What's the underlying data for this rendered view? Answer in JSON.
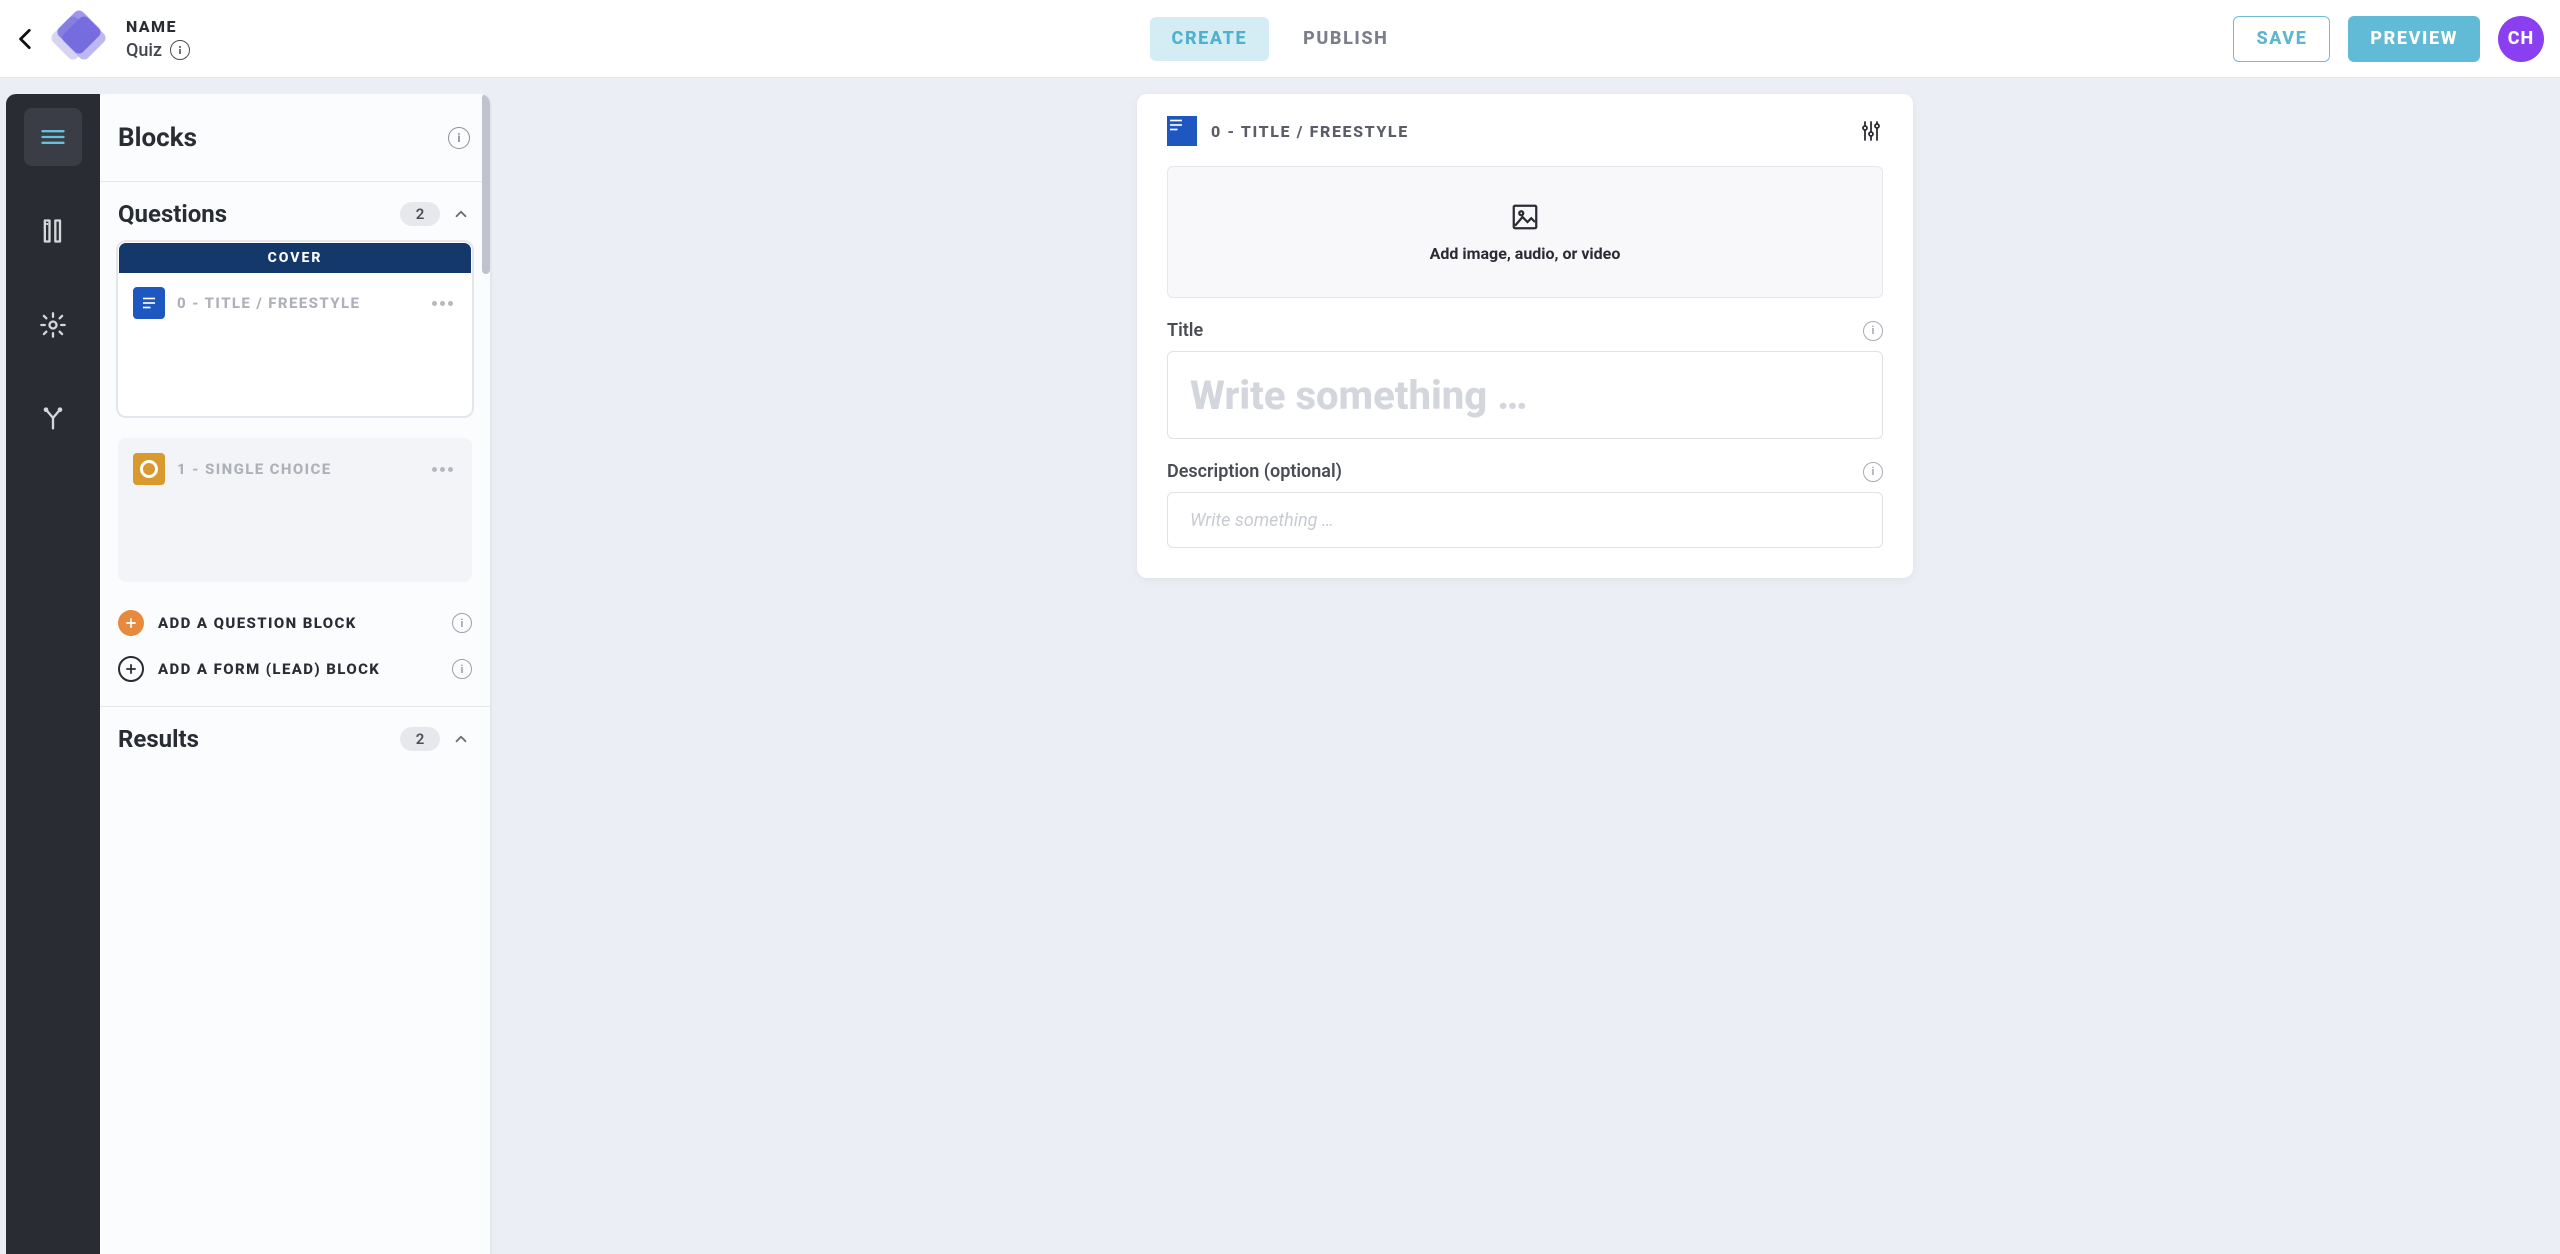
{
  "header": {
    "name_label": "NAME",
    "subtitle": "Quiz",
    "tab_create": "CREATE",
    "tab_publish": "PUBLISH",
    "save": "SAVE",
    "preview": "PREVIEW",
    "avatar": "CH"
  },
  "panel": {
    "title": "Blocks",
    "sections": {
      "questions": {
        "title": "Questions",
        "count": "2"
      },
      "results": {
        "title": "Results",
        "count": "2"
      }
    },
    "cover_label": "COVER",
    "cards": [
      {
        "label": "0 - TITLE / FREESTYLE"
      },
      {
        "label": "1 - SINGLE CHOICE"
      }
    ],
    "add_question": "ADD A QUESTION BLOCK",
    "add_form": "ADD A FORM (LEAD) BLOCK"
  },
  "editor": {
    "heading": "0 - TITLE / FREESTYLE",
    "media_label": "Add image, audio, or video",
    "title_label": "Title",
    "title_ph": "Write something …",
    "desc_label": "Description (optional)",
    "desc_ph": "Write something …"
  }
}
